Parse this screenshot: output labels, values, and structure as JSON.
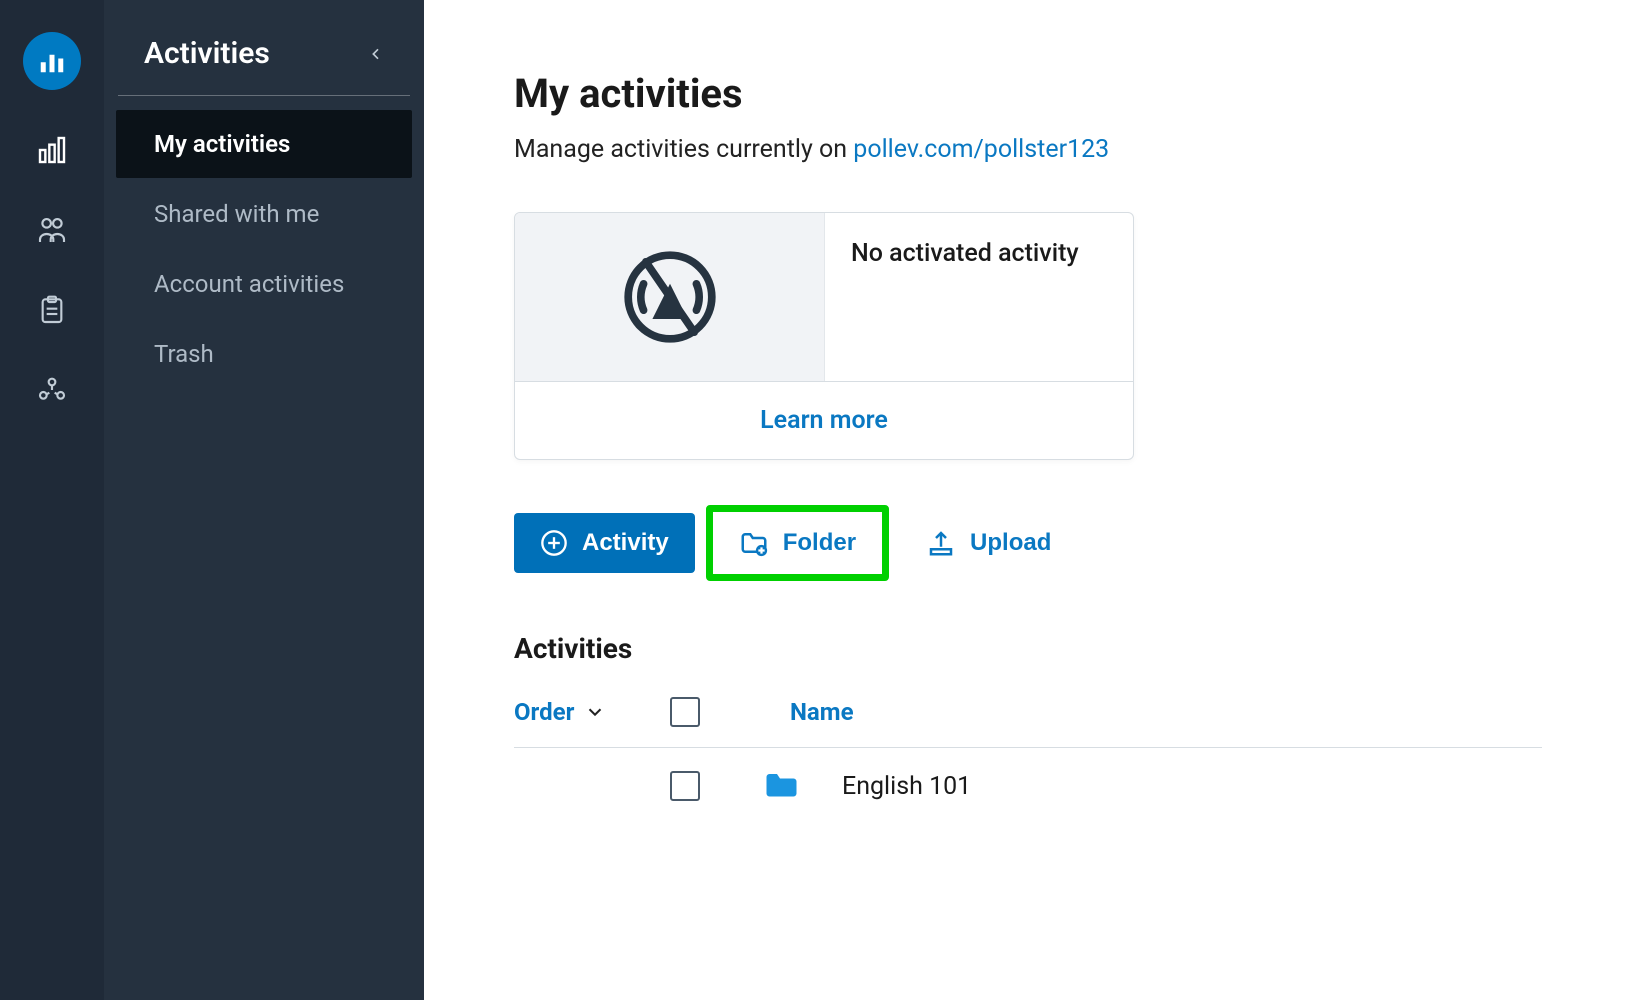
{
  "sidebar": {
    "title": "Activities",
    "items": [
      {
        "label": "My activities",
        "active": true
      },
      {
        "label": "Shared with me",
        "active": false
      },
      {
        "label": "Account activities",
        "active": false
      },
      {
        "label": "Trash",
        "active": false
      }
    ]
  },
  "page": {
    "title": "My activities",
    "subtitle_prefix": "Manage activities currently on ",
    "pollev_link": "pollev.com/pollster123"
  },
  "card": {
    "status": "No activated activity",
    "learn_more": "Learn more"
  },
  "actions": {
    "activity": "Activity",
    "folder": "Folder",
    "upload": "Upload"
  },
  "list": {
    "section_title": "Activities",
    "col_order": "Order",
    "col_name": "Name",
    "rows": [
      {
        "name": "English 101",
        "type": "folder"
      }
    ]
  }
}
